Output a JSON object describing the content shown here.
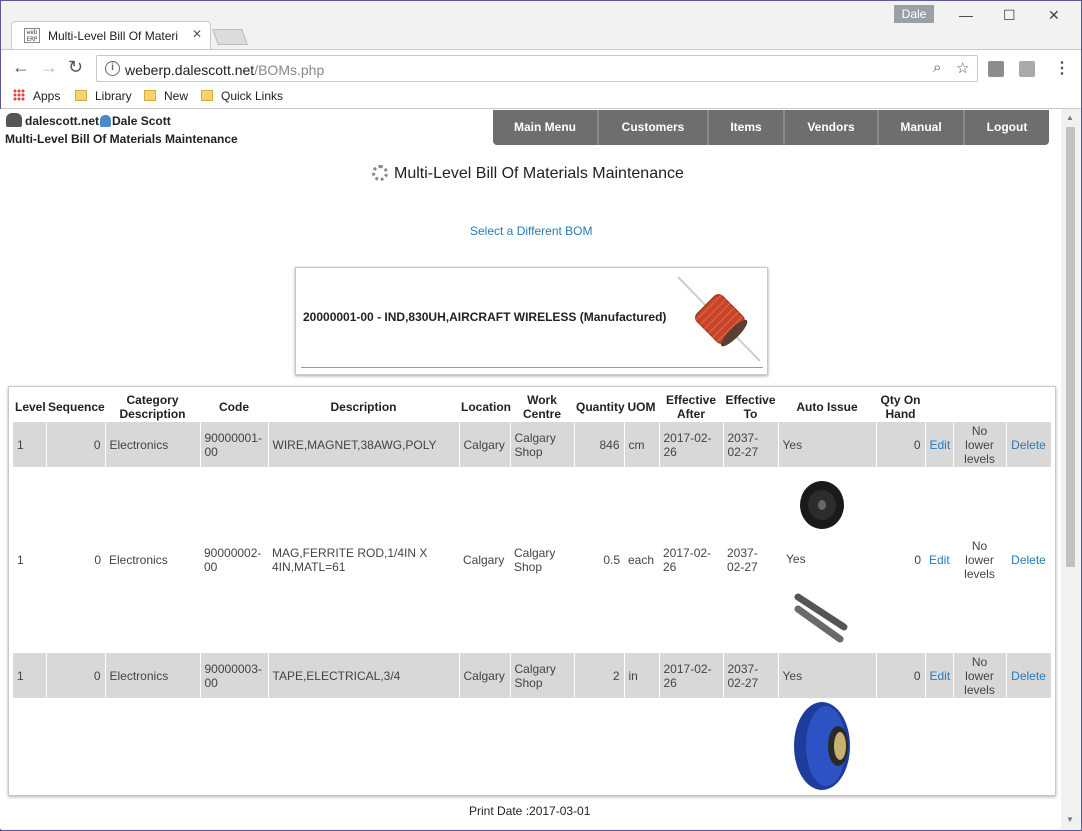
{
  "browser": {
    "tab_title": "Multi-Level Bill Of Materi",
    "tab_favicon": "web ERP",
    "profile_badge": "Dale",
    "url_host": "weberp.dalescott.net",
    "url_path": "/BOMs.php",
    "bookmarks": [
      {
        "label": "Apps",
        "icon": "apps-grid-icon"
      },
      {
        "label": "Library",
        "icon": "folder-icon"
      },
      {
        "label": "New",
        "icon": "folder-icon"
      },
      {
        "label": "Quick Links",
        "icon": "folder-icon"
      }
    ]
  },
  "header": {
    "site": "dalescott.net",
    "user": "Dale Scott",
    "page_heading": "Multi-Level Bill Of Materials Maintenance"
  },
  "nav": [
    "Main Menu",
    "Customers",
    "Items",
    "Vendors",
    "Manual",
    "Logout"
  ],
  "main": {
    "title": "Multi-Level Bill Of Materials Maintenance",
    "select_link": "Select a Different BOM",
    "bom_item": "20000001-00 - IND,830UH,AIRCRAFT WIRELESS (Manufactured)"
  },
  "table": {
    "headers": [
      "Level",
      "Sequence",
      "Category Description",
      "Code",
      "Description",
      "Location",
      "Work Centre",
      "Quantity",
      "UOM",
      "Effective After",
      "Effective To",
      "Auto Issue",
      "Qty On Hand",
      "",
      "",
      ""
    ],
    "rows": [
      {
        "level": "1",
        "sequence": "0",
        "category": "Electronics",
        "code": "90000001-00",
        "description": "WIRE,MAGNET,38AWG,POLY",
        "location": "Calgary",
        "work_centre": "Calgary Shop",
        "quantity": "846",
        "uom": "cm",
        "eff_after": "2017-02-26",
        "eff_to": "2037-02-27",
        "auto_issue": "Yes",
        "qty_on_hand": "0",
        "edit": "Edit",
        "lower": "No lower levels",
        "delete": "Delete",
        "image": "wire-spool"
      },
      {
        "level": "1",
        "sequence": "0",
        "category": "Electronics",
        "code": "90000002-00",
        "description": "MAG,FERRITE ROD,1/4IN X 4IN,MATL=61",
        "location": "Calgary",
        "work_centre": "Calgary Shop",
        "quantity": "0.5",
        "uom": "each",
        "eff_after": "2017-02-26",
        "eff_to": "2037-02-27",
        "auto_issue": "Yes",
        "qty_on_hand": "0",
        "edit": "Edit",
        "lower": "No lower levels",
        "delete": "Delete",
        "image": "ferrite-rods"
      },
      {
        "level": "1",
        "sequence": "0",
        "category": "Electronics",
        "code": "90000003-00",
        "description": "TAPE,ELECTRICAL,3/4",
        "location": "Calgary",
        "work_centre": "Calgary Shop",
        "quantity": "2",
        "uom": "in",
        "eff_after": "2017-02-26",
        "eff_to": "2037-02-27",
        "auto_issue": "Yes",
        "qty_on_hand": "0",
        "edit": "Edit",
        "lower": "No lower levels",
        "delete": "Delete",
        "image": "electrical-tape"
      }
    ]
  },
  "footer": {
    "print_date": "Print Date :2017-03-01"
  }
}
